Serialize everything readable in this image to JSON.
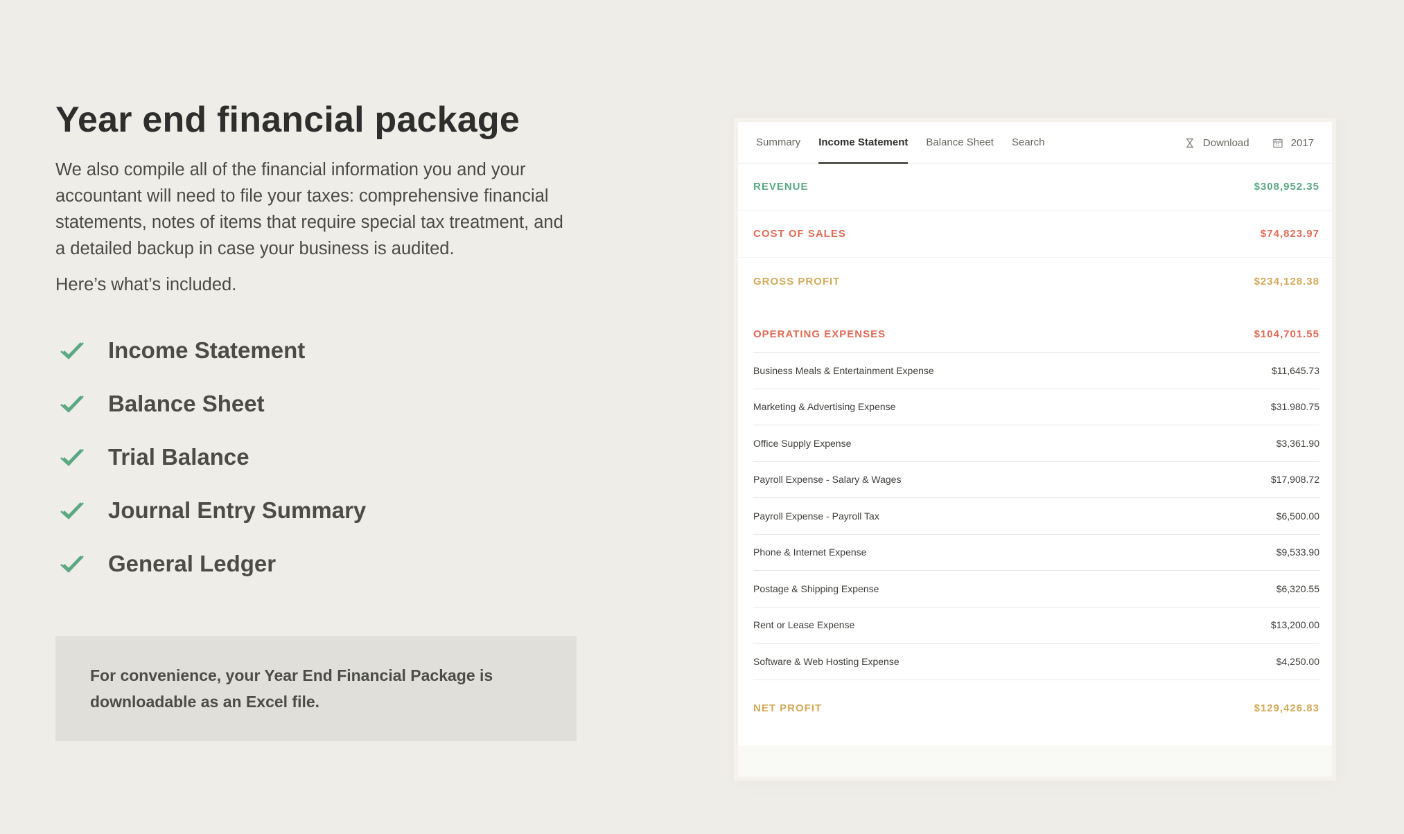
{
  "title": "Year end financial package",
  "intro": "We also compile all of the financial information you and your accountant will need to file your taxes: comprehensive financial statements, notes of items that require special tax treatment, and a detailed backup in case your business is audited.",
  "included": "Here’s what’s included.",
  "checklist": [
    {
      "label": "Income Statement",
      "icon": "check-icon"
    },
    {
      "label": "Balance Sheet",
      "icon": "check-icon"
    },
    {
      "label": "Trial Balance",
      "icon": "check-icon"
    },
    {
      "label": "Journal Entry Summary",
      "icon": "check-icon"
    },
    {
      "label": "General Ledger",
      "icon": "check-icon"
    }
  ],
  "note": "For convenience, your Year End Financial Package is downloadable as an Excel file.",
  "panel": {
    "tabs": [
      {
        "label": "Summary"
      },
      {
        "label": "Income Statement",
        "active": true
      },
      {
        "label": "Balance Sheet"
      },
      {
        "label": "Search"
      }
    ],
    "download_label": "Download",
    "year_label": "2017",
    "revenue": {
      "label": "REVENUE",
      "value": "$308,952.35"
    },
    "cost_of_sales": {
      "label": "COST OF SALES",
      "value": "$74,823.97"
    },
    "gross_profit": {
      "label": "GROSS PROFIT",
      "value": "$234,128.38"
    },
    "operating_expenses": {
      "label": "OPERATING EXPENSES",
      "value": "$104,701.55"
    },
    "expenses": [
      {
        "name": "Business Meals & Entertainment Expense",
        "amount": "$11,645.73"
      },
      {
        "name": "Marketing & Advertising Expense",
        "amount": "$31.980.75"
      },
      {
        "name": "Office Supply Expense",
        "amount": "$3,361.90"
      },
      {
        "name": "Payroll Expense - Salary & Wages",
        "amount": "$17,908.72"
      },
      {
        "name": "Payroll Expense - Payroll Tax",
        "amount": "$6,500.00"
      },
      {
        "name": "Phone & Internet Expense",
        "amount": "$9,533.90"
      },
      {
        "name": "Postage & Shipping Expense",
        "amount": "$6,320.55"
      },
      {
        "name": "Rent or Lease Expense",
        "amount": "$13,200.00"
      },
      {
        "name": "Software & Web Hosting Expense",
        "amount": "$4,250.00"
      }
    ],
    "net_profit": {
      "label": "NET PROFIT",
      "value": "$129,426.83"
    }
  },
  "colors": {
    "background": "#eeede8",
    "check": "#5aa883",
    "revenue": "#5aa883",
    "expense": "#df6b56",
    "profit": "#d3a959"
  }
}
